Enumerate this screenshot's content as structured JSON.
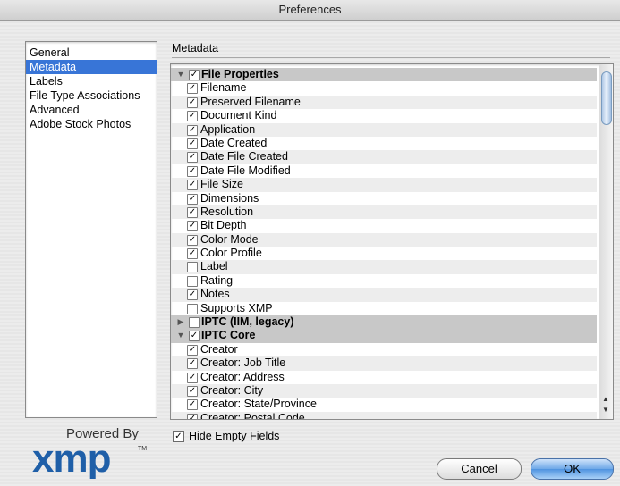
{
  "window": {
    "title": "Preferences"
  },
  "sidebar": {
    "items": [
      {
        "label": "General",
        "selected": false
      },
      {
        "label": "Metadata",
        "selected": true
      },
      {
        "label": "Labels",
        "selected": false
      },
      {
        "label": "File Type Associations",
        "selected": false
      },
      {
        "label": "Advanced",
        "selected": false
      },
      {
        "label": "Adobe Stock Photos",
        "selected": false
      }
    ]
  },
  "main": {
    "section_title": "Metadata",
    "rows": [
      {
        "type": "group",
        "label": "File Properties",
        "checked": true,
        "expanded": true
      },
      {
        "type": "item",
        "label": "Filename",
        "checked": true
      },
      {
        "type": "item",
        "label": "Preserved Filename",
        "checked": true
      },
      {
        "type": "item",
        "label": "Document Kind",
        "checked": true
      },
      {
        "type": "item",
        "label": "Application",
        "checked": true
      },
      {
        "type": "item",
        "label": "Date Created",
        "checked": true
      },
      {
        "type": "item",
        "label": "Date File Created",
        "checked": true
      },
      {
        "type": "item",
        "label": "Date File Modified",
        "checked": true
      },
      {
        "type": "item",
        "label": "File Size",
        "checked": true
      },
      {
        "type": "item",
        "label": "Dimensions",
        "checked": true
      },
      {
        "type": "item",
        "label": "Resolution",
        "checked": true
      },
      {
        "type": "item",
        "label": "Bit Depth",
        "checked": true
      },
      {
        "type": "item",
        "label": "Color Mode",
        "checked": true
      },
      {
        "type": "item",
        "label": "Color Profile",
        "checked": true
      },
      {
        "type": "item",
        "label": "Label",
        "checked": false
      },
      {
        "type": "item",
        "label": "Rating",
        "checked": false
      },
      {
        "type": "item",
        "label": "Notes",
        "checked": true
      },
      {
        "type": "item",
        "label": "Supports XMP",
        "checked": false
      },
      {
        "type": "group",
        "label": "IPTC (IIM, legacy)",
        "checked": false,
        "expanded": false
      },
      {
        "type": "group",
        "label": "IPTC Core",
        "checked": true,
        "expanded": true
      },
      {
        "type": "item",
        "label": "Creator",
        "checked": true
      },
      {
        "type": "item",
        "label": "Creator: Job Title",
        "checked": true
      },
      {
        "type": "item",
        "label": "Creator: Address",
        "checked": true
      },
      {
        "type": "item",
        "label": "Creator: City",
        "checked": true
      },
      {
        "type": "item",
        "label": "Creator: State/Province",
        "checked": true
      },
      {
        "type": "item",
        "label": "Creator: Postal Code",
        "checked": true
      }
    ],
    "hide_empty_fields": {
      "label": "Hide Empty Fields",
      "checked": true
    }
  },
  "buttons": {
    "cancel": "Cancel",
    "ok": "OK"
  },
  "branding": {
    "powered_by": "Powered By",
    "logo_text": "xmp",
    "trademark": "TM"
  },
  "colors": {
    "selection": "#3875d7",
    "logo_blue": "#1f5fa8",
    "group_row": "#c8c8c8"
  },
  "icons": {
    "check": "checkmark-icon",
    "expand": "disclosure-triangle-icon"
  }
}
